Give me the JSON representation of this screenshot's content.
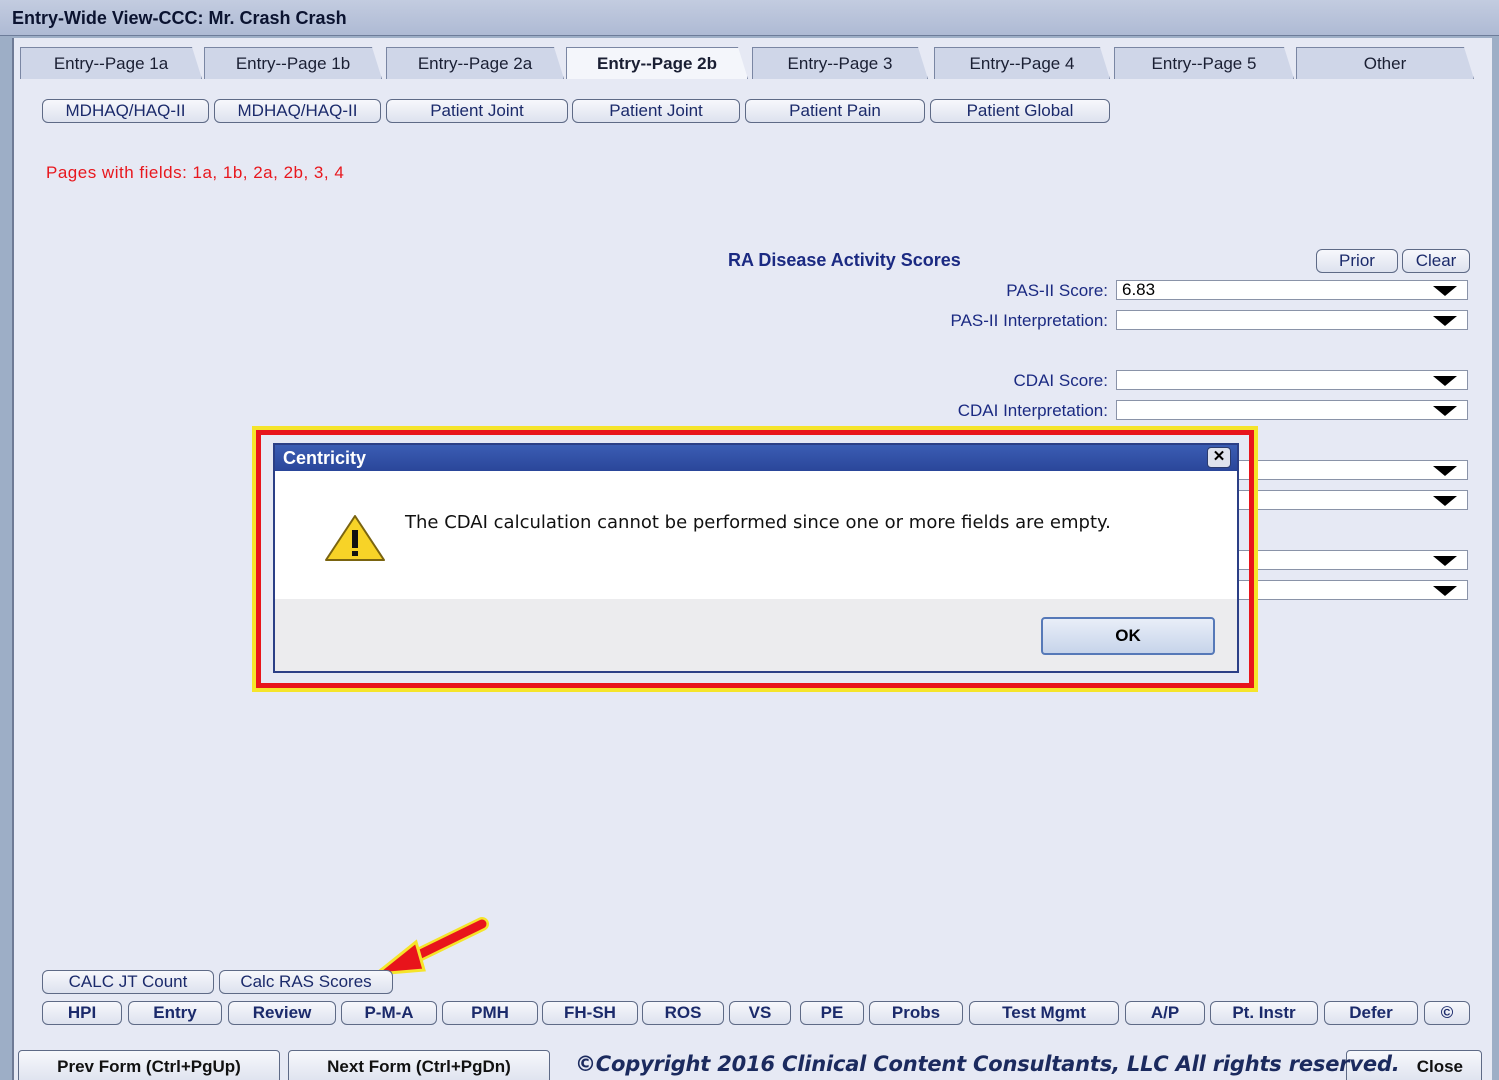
{
  "window": {
    "title": "Entry-Wide View-CCC:  Mr. Crash Crash"
  },
  "tabs": [
    {
      "label": "Entry--Page 1a"
    },
    {
      "label": "Entry--Page 1b"
    },
    {
      "label": "Entry--Page 2a"
    },
    {
      "label": "Entry--Page 2b",
      "active": true
    },
    {
      "label": "Entry--Page 3"
    },
    {
      "label": "Entry--Page 4"
    },
    {
      "label": "Entry--Page 5"
    },
    {
      "label": "Other"
    }
  ],
  "top_buttons": [
    {
      "label": "MDHAQ/HAQ-II"
    },
    {
      "label": "MDHAQ/HAQ-II"
    },
    {
      "label": "Patient Joint"
    },
    {
      "label": "Patient Joint"
    },
    {
      "label": "Patient Pain"
    },
    {
      "label": "Patient Global"
    }
  ],
  "pages_note": "Pages with fields:  1a,  1b,  2a,  2b,  3,  4",
  "scores": {
    "title": "RA Disease Activity Scores",
    "prior_label": "Prior",
    "clear_label": "Clear",
    "fields": [
      {
        "label": "PAS-II Score:",
        "value": "6.83"
      },
      {
        "label": "PAS-II Interpretation:",
        "value": ""
      },
      {
        "label": "CDAI Score:",
        "value": ""
      },
      {
        "label": "CDAI Interpretation:",
        "value": ""
      }
    ]
  },
  "dialog": {
    "title": "Centricity",
    "close_glyph": "✕",
    "message": "The CDAI calculation cannot be performed since one or more fields are empty.",
    "ok_label": "OK",
    "icon": "warning-icon"
  },
  "calc_buttons": [
    {
      "label": "CALC JT Count"
    },
    {
      "label": "Calc RAS Scores"
    }
  ],
  "nav_buttons": [
    {
      "label": "HPI"
    },
    {
      "label": "Entry"
    },
    {
      "label": "Review"
    },
    {
      "label": "P-M-A"
    },
    {
      "label": "PMH"
    },
    {
      "label": "FH-SH"
    },
    {
      "label": "ROS"
    },
    {
      "label": "VS"
    },
    {
      "label": "PE"
    },
    {
      "label": "Probs"
    },
    {
      "label": "Test Mgmt"
    },
    {
      "label": "A/P"
    },
    {
      "label": "Pt. Instr"
    },
    {
      "label": "Defer"
    },
    {
      "label": "©"
    }
  ],
  "footer": {
    "prev_label": "Prev Form (Ctrl+PgUp)",
    "next_label": "Next Form (Ctrl+PgDn)",
    "close_label": "Close",
    "copyright": "©Copyright 2016 Clinical Content Consultants, LLC All rights reserved."
  },
  "colors": {
    "highlight_border": "#e8141b",
    "highlight_glow": "#f5e42a",
    "pages_note": "#e8171d",
    "label_blue": "#1b2a82"
  }
}
